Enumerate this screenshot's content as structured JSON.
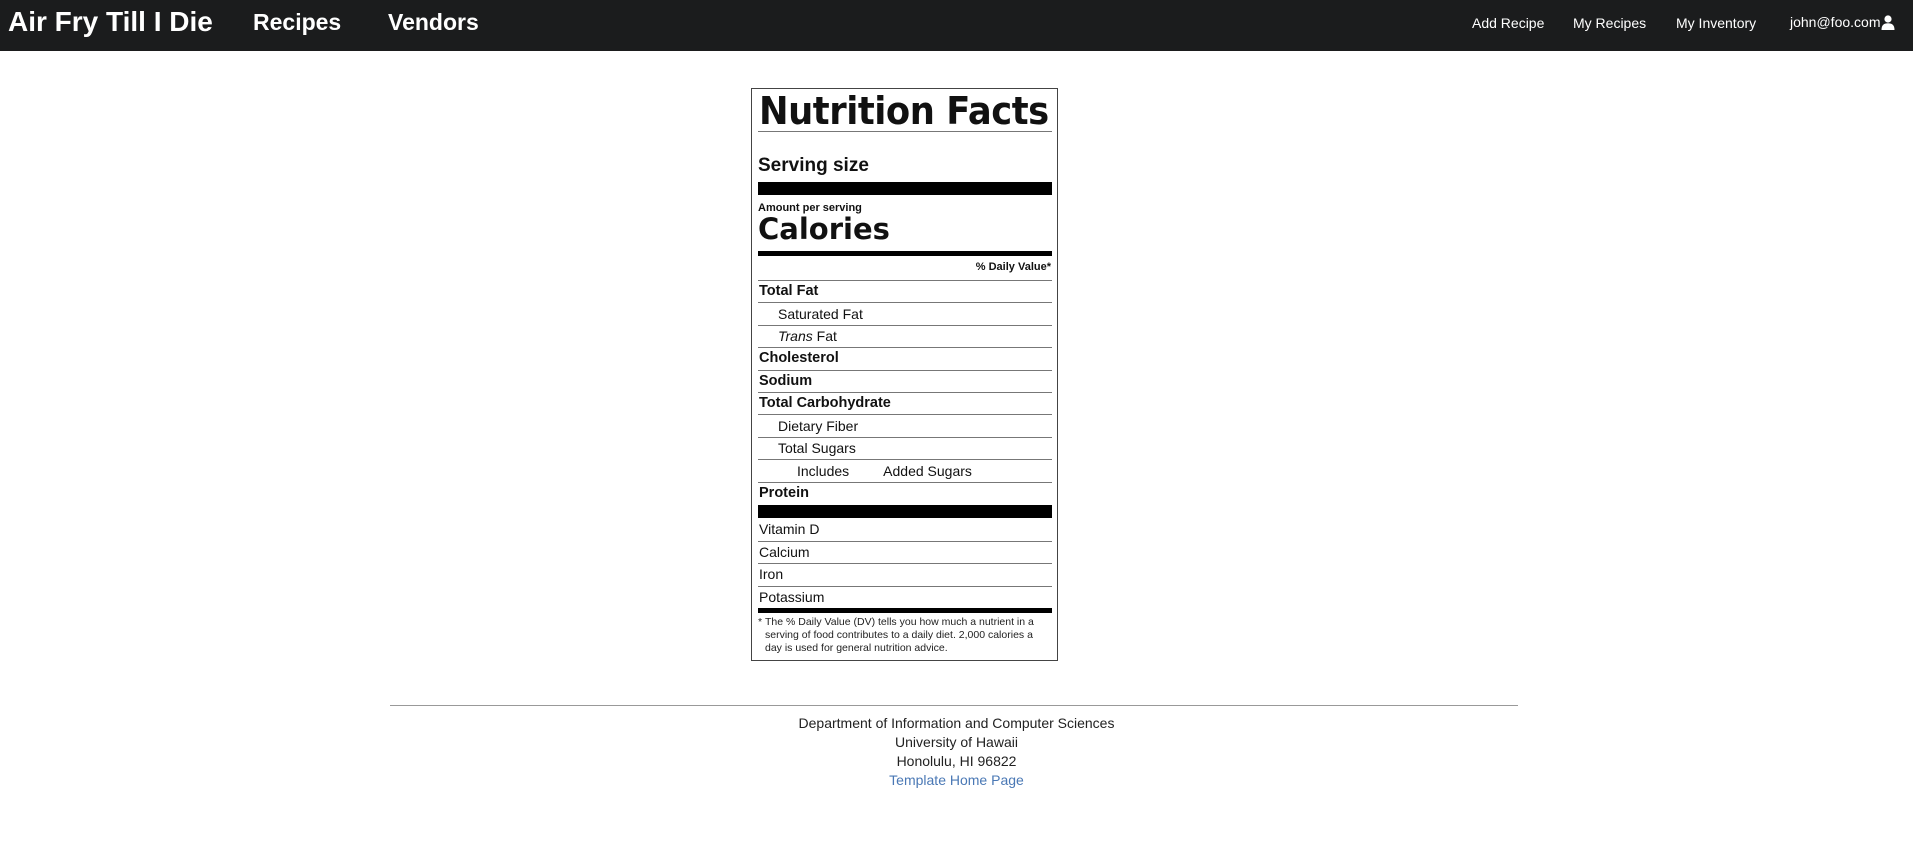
{
  "navbar": {
    "brand": "Air Fry Till I Die",
    "main_links": [
      "Recipes",
      "Vendors"
    ],
    "right_links": [
      "Add Recipe",
      "My Recipes",
      "My Inventory"
    ],
    "user": "john@foo.com",
    "user_icon": "user-icon",
    "background": "#1b1c1d"
  },
  "nutrition": {
    "title": "Nutrition Facts",
    "serving_size": "Serving size",
    "amount_per_serving": "Amount per serving",
    "calories": "Calories",
    "daily_value_header": "% Daily Value*",
    "rows": {
      "total_fat": "Total Fat",
      "saturated_fat": "Saturated Fat",
      "trans_prefix": "Trans",
      "trans_suffix": " Fat",
      "cholesterol": "Cholesterol",
      "sodium": "Sodium",
      "total_carbohydrate": "Total Carbohydrate",
      "dietary_fiber": "Dietary Fiber",
      "total_sugars": "Total Sugars",
      "includes": "Includes",
      "added_sugars": "Added Sugars",
      "protein": "Protein",
      "vitamin_d": "Vitamin D",
      "calcium": "Calcium",
      "iron": "Iron",
      "potassium": "Potassium"
    },
    "footnote_star": "*",
    "footnote": "The % Daily Value (DV) tells you how much a nutrient in a serving of food contributes to a daily diet. 2,000 calories a day is used for general nutrition advice."
  },
  "footer": {
    "line1": "Department of Information and Computer Sciences",
    "line2": "University of Hawaii",
    "line3": "Honolulu, HI 96822",
    "link": "Template Home Page",
    "link_color": "#4a78b5"
  }
}
